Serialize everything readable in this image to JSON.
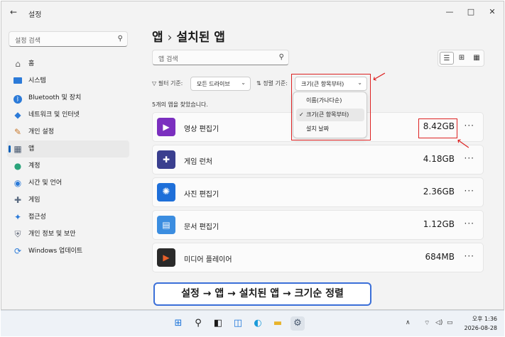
{
  "window": {
    "title": "설정",
    "controls": [
      "—",
      "□",
      "✕"
    ]
  },
  "sidebar": {
    "search_placeholder": "설정 검색",
    "items": [
      {
        "label": "홈",
        "icon": "home-icon"
      },
      {
        "label": "시스템",
        "icon": "system-icon"
      },
      {
        "label": "Bluetooth 및 장치",
        "icon": "bluetooth-icon"
      },
      {
        "label": "네트워크 및 인터넷",
        "icon": "network-icon"
      },
      {
        "label": "개인 설정",
        "icon": "brush-icon"
      },
      {
        "label": "앱",
        "icon": "apps-icon"
      },
      {
        "label": "계정",
        "icon": "account-icon"
      },
      {
        "label": "시간 및 언어",
        "icon": "globe-icon"
      },
      {
        "label": "게임",
        "icon": "gamepad-icon"
      },
      {
        "label": "접근성",
        "icon": "accessibility-icon"
      },
      {
        "label": "개인 정보 및 보안",
        "icon": "shield-icon"
      },
      {
        "label": "Windows 업데이트",
        "icon": "update-icon"
      }
    ]
  },
  "main": {
    "breadcrumb": {
      "parent": "앱",
      "separator": "›",
      "current": "설치된 앱"
    },
    "search_placeholder": "앱 검색",
    "filter": {
      "label": "필터 기준:",
      "value": "모든 드라이브"
    },
    "sort": {
      "label": "정렬 기준:",
      "value": "크기(큰 항목부터)"
    },
    "sort_options": [
      "이름(가나다순)",
      "크기(큰 항목부터)",
      "설치 날짜"
    ],
    "count_text": "5개의 앱을 찾았습니다.",
    "apps": [
      {
        "name": "영상 편집기",
        "size": "8.42GB",
        "color": "#7b2fbf"
      },
      {
        "name": "게임 런처",
        "size": "4.18GB",
        "color": "#3a3f8f"
      },
      {
        "name": "사진 편집기",
        "size": "2.36GB",
        "color": "#1e6fd9"
      },
      {
        "name": "문서 편집기",
        "size": "1.12GB",
        "color": "#3b8de0"
      },
      {
        "name": "미디어 플레이어",
        "size": "684MB",
        "color": "#c8401a"
      }
    ],
    "more_label": "···"
  },
  "banner": "설정 → 앱 → 설치된 앱 → 크기순 정렬",
  "taskbar": {
    "tray": [
      "∧",
      "⌔",
      "◁)",
      "▭"
    ],
    "time": "오후 1:36",
    "date": "2026-08-28"
  },
  "colors": {
    "accent": "#005fb8",
    "highlight": "#dd2222",
    "banner_border": "#3b6fd8"
  }
}
